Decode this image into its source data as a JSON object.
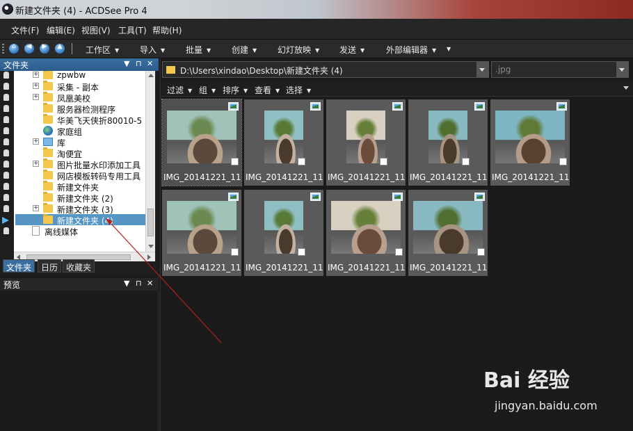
{
  "window": {
    "title": "新建文件夹 (4) - ACDSee Pro 4"
  },
  "menubar": {
    "items": [
      "文件(F)",
      "编辑(E)",
      "视图(V)",
      "工具(T)",
      "帮助(H)"
    ]
  },
  "toolbar": {
    "nav": [
      "home",
      "back",
      "forward",
      "up"
    ],
    "items": [
      "工作区",
      "导入",
      "批量",
      "创建",
      "幻灯放映",
      "发送",
      "外部编辑器"
    ]
  },
  "folders_panel": {
    "title": "文件夹",
    "tree": [
      {
        "label": "zpwbw",
        "icon": "folder",
        "expander": "+"
      },
      {
        "label": "采集 - 副本",
        "icon": "folder",
        "expander": "+"
      },
      {
        "label": "凤凰美校",
        "icon": "folder",
        "expander": "+"
      },
      {
        "label": "服务器检测程序",
        "icon": "folder",
        "expander": ""
      },
      {
        "label": "华美飞天侠折80010-5",
        "icon": "folder",
        "expander": ""
      },
      {
        "label": "家庭组",
        "icon": "globe",
        "expander": ""
      },
      {
        "label": "库",
        "icon": "library",
        "expander": "+"
      },
      {
        "label": "淘便宜",
        "icon": "folder",
        "expander": ""
      },
      {
        "label": "图片批量水印添加工具",
        "icon": "folder",
        "expander": "+"
      },
      {
        "label": "网店模板转码专用工具",
        "icon": "folder",
        "expander": ""
      },
      {
        "label": "新建文件夹",
        "icon": "folder",
        "expander": ""
      },
      {
        "label": "新建文件夹 (2)",
        "icon": "folder",
        "expander": ""
      },
      {
        "label": "新建文件夹 (3)",
        "icon": "folder",
        "expander": "+"
      },
      {
        "label": "新建文件夹 (4)",
        "icon": "folder",
        "expander": "",
        "selected": true
      },
      {
        "label": "离线媒体",
        "icon": "disc",
        "expander": ""
      }
    ],
    "tabs": [
      "文件夹",
      "日历",
      "收藏夹"
    ],
    "active_tab": 0
  },
  "preview_panel": {
    "title": "预览"
  },
  "address_bar": {
    "path": "D:\\Users\\xindao\\Desktop\\新建文件夹 (4)"
  },
  "filter_box": {
    "value": ".jpg"
  },
  "browse_toolbar": {
    "items": [
      "过滤",
      "组",
      "排序",
      "查看",
      "选择"
    ]
  },
  "thumbnails": [
    {
      "caption": "IMG_20141221_11...",
      "orientation": "landscape"
    },
    {
      "caption": "IMG_20141221_11...",
      "orientation": "portrait"
    },
    {
      "caption": "IMG_20141221_11...",
      "orientation": "portrait"
    },
    {
      "caption": "IMG_20141221_11...",
      "orientation": "portrait"
    },
    {
      "caption": "IMG_20141221_11...",
      "orientation": "landscape"
    },
    {
      "caption": "IMG_20141221_11...",
      "orientation": "landscape"
    },
    {
      "caption": "IMG_20141221_11...",
      "orientation": "portrait"
    },
    {
      "caption": "IMG_20141221_11...",
      "orientation": "landscape"
    },
    {
      "caption": "IMG_20141221_11...",
      "orientation": "landscape"
    }
  ],
  "watermark": {
    "logo": "Bai 经验",
    "site": "jingyan.baidu.com"
  },
  "colors": {
    "accent": "#3b6fa0",
    "selection": "#5796c4",
    "annotation": "#b0201c"
  }
}
